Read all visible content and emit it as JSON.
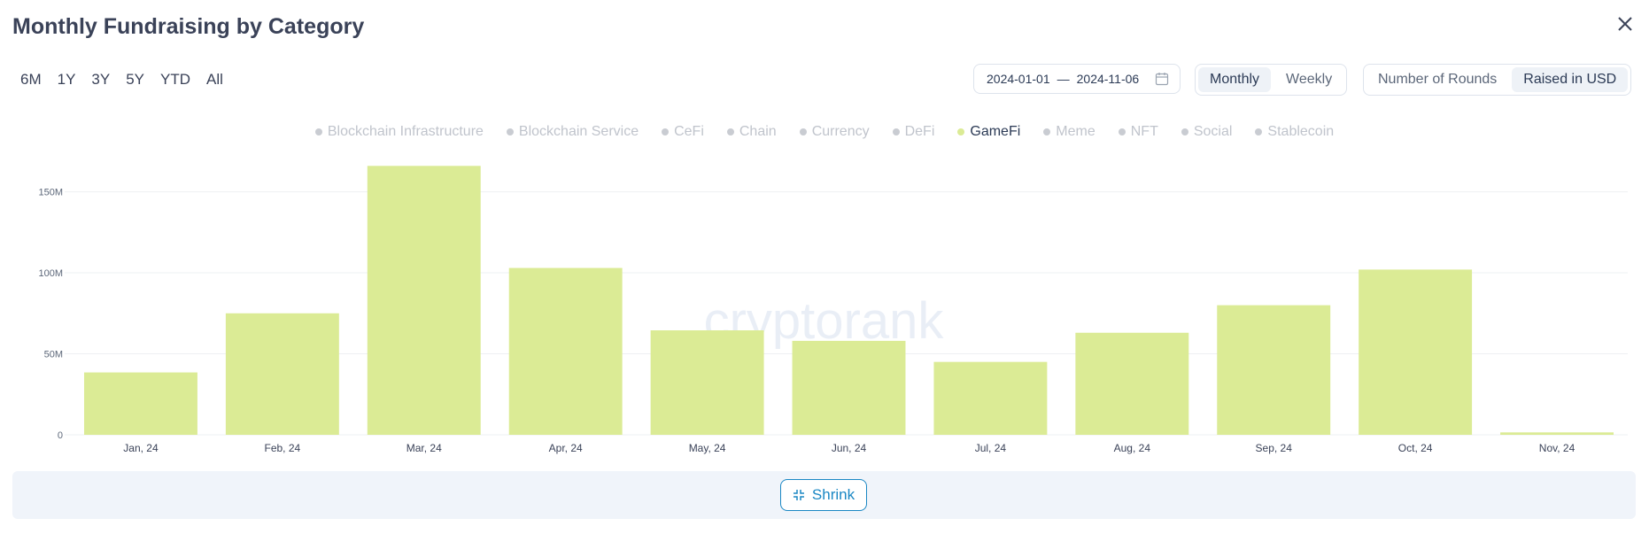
{
  "title": "Monthly Fundraising by Category",
  "periods": [
    "6M",
    "1Y",
    "3Y",
    "5Y",
    "YTD",
    "All"
  ],
  "date_range": {
    "start": "2024-01-01",
    "separator": "—",
    "end": "2024-11-06"
  },
  "interval": {
    "options": [
      "Monthly",
      "Weekly"
    ],
    "active": "Monthly"
  },
  "metric": {
    "options": [
      "Number of Rounds",
      "Raised in USD"
    ],
    "active": "Raised in USD"
  },
  "legend": {
    "items": [
      "Blockchain Infrastructure",
      "Blockchain Service",
      "CeFi",
      "Chain",
      "Currency",
      "DeFi",
      "GameFi",
      "Meme",
      "NFT",
      "Social",
      "Stablecoin"
    ],
    "active": "GameFi"
  },
  "watermark": "cryptorank",
  "shrink_label": "Shrink",
  "colors": {
    "bar": "#dbeb95",
    "accent": "#1a87c4",
    "active_dot": "#dbeb95"
  },
  "icons": {
    "close": "close-icon",
    "calendar": "calendar-icon",
    "shrink": "shrink-icon"
  },
  "chart_data": {
    "type": "bar",
    "categories": [
      "Jan, 24",
      "Feb, 24",
      "Mar, 24",
      "Apr, 24",
      "May, 24",
      "Jun, 24",
      "Jul, 24",
      "Aug, 24",
      "Sep, 24",
      "Oct, 24",
      "Nov, 24"
    ],
    "series": [
      {
        "name": "GameFi",
        "values": [
          38.5,
          75,
          166,
          103,
          64.5,
          58,
          45,
          63,
          80,
          102,
          1.5
        ]
      }
    ],
    "y_ticks": [
      "0",
      "50M",
      "100M",
      "150M"
    ],
    "y_tick_values": [
      0,
      50,
      100,
      150
    ],
    "ylim": [
      0,
      170
    ],
    "grid": true,
    "legend_position": "top-center"
  }
}
